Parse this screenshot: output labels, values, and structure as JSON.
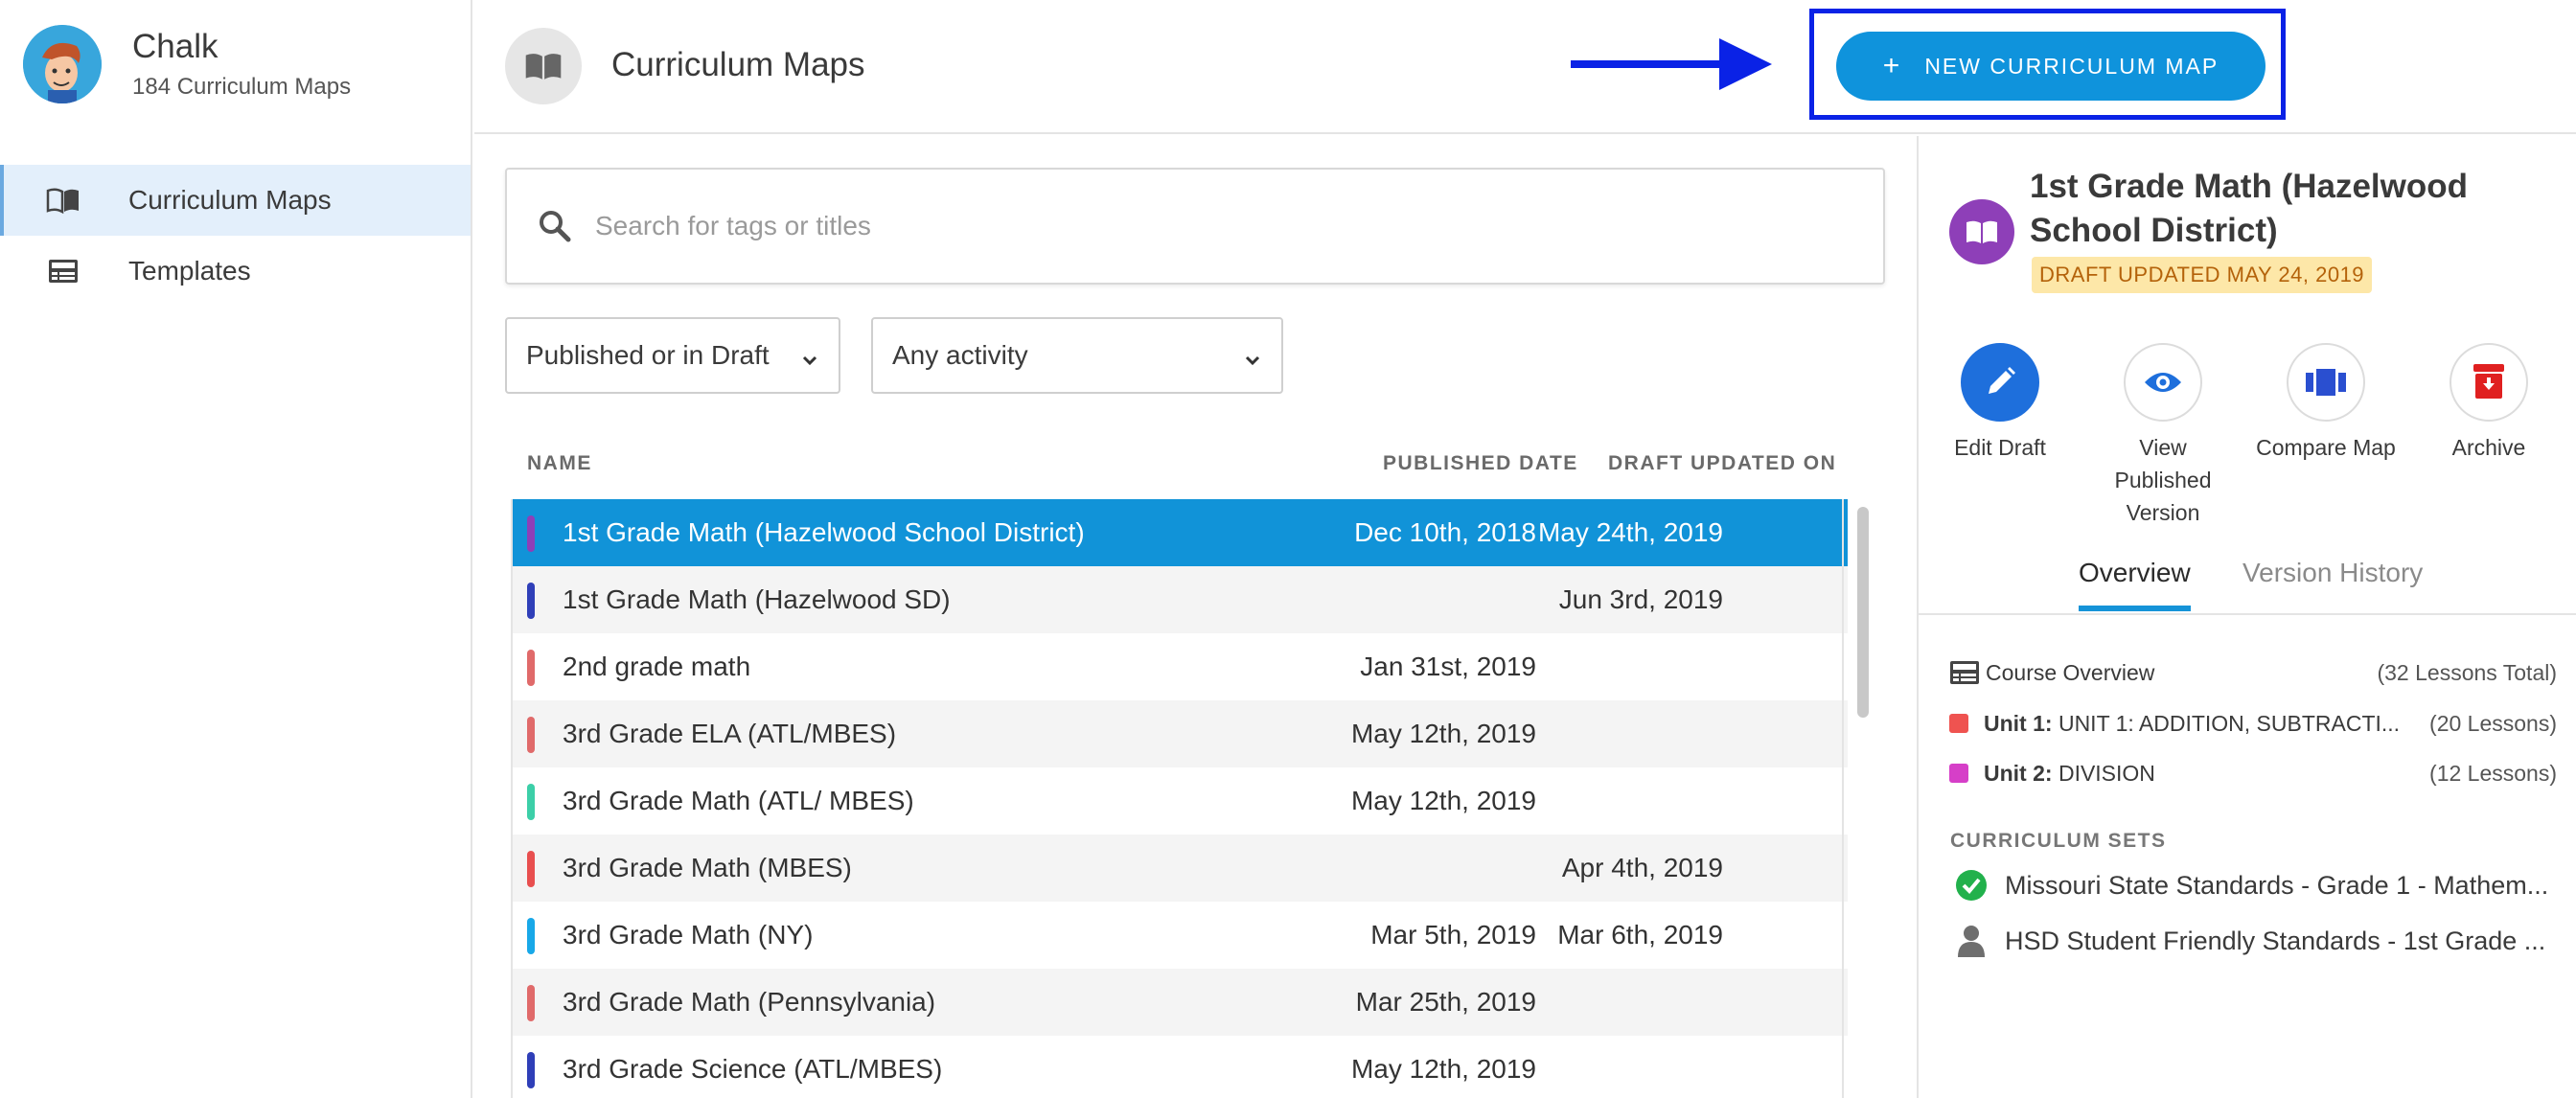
{
  "app": {
    "name": "Chalk",
    "subtitle": "184 Curriculum Maps"
  },
  "sidebar": {
    "items": [
      {
        "label": "Curriculum Maps",
        "icon": "book-icon",
        "active": true
      },
      {
        "label": "Templates",
        "icon": "template-icon",
        "active": false
      }
    ]
  },
  "header": {
    "title": "Curriculum Maps",
    "new_button_label": "NEW CURRICULUM MAP"
  },
  "search": {
    "placeholder": "Search for tags or titles"
  },
  "filters": {
    "status": "Published or in Draft",
    "activity": "Any activity"
  },
  "table": {
    "columns": {
      "name": "NAME",
      "published": "PUBLISHED DATE",
      "draft": "DRAFT UPDATED ON"
    },
    "rows": [
      {
        "name": "1st Grade Math (Hazelwood School District)",
        "published": "Dec 10th, 2018",
        "draft": "May 24th, 2019",
        "color": "#8e3fb8",
        "selected": true
      },
      {
        "name": "1st Grade Math (Hazelwood SD)",
        "published": "",
        "draft": "Jun 3rd, 2019",
        "color": "#2f3fb8",
        "selected": false
      },
      {
        "name": "2nd grade math",
        "published": "Jan 31st, 2019",
        "draft": "",
        "color": "#e06a6a",
        "selected": false
      },
      {
        "name": "3rd Grade ELA (ATL/MBES)",
        "published": "May 12th, 2019",
        "draft": "",
        "color": "#e06a6a",
        "selected": false
      },
      {
        "name": "3rd Grade Math (ATL/ MBES)",
        "published": "May 12th, 2019",
        "draft": "",
        "color": "#3ccfa8",
        "selected": false
      },
      {
        "name": "3rd Grade Math (MBES)",
        "published": "",
        "draft": "Apr 4th, 2019",
        "color": "#e84f4f",
        "selected": false
      },
      {
        "name": "3rd Grade Math (NY)",
        "published": "Mar 5th, 2019",
        "draft": "Mar 6th, 2019",
        "color": "#18a8e8",
        "selected": false
      },
      {
        "name": "3rd Grade Math (Pennsylvania)",
        "published": "Mar 25th, 2019",
        "draft": "",
        "color": "#e06a6a",
        "selected": false
      },
      {
        "name": "3rd Grade Science (ATL/MBES)",
        "published": "May 12th, 2019",
        "draft": "",
        "color": "#2f3fb8",
        "selected": false
      }
    ]
  },
  "detail": {
    "title": "1st Grade Math (Hazelwood School District)",
    "badge": "DRAFT UPDATED MAY 24, 2019",
    "actions": [
      {
        "label": "Edit Draft",
        "icon": "pencil-icon"
      },
      {
        "label": "View Published Version",
        "icon": "eye-icon"
      },
      {
        "label": "Compare Map",
        "icon": "compare-icon"
      },
      {
        "label": "Archive",
        "icon": "archive-icon"
      }
    ],
    "tabs": [
      "Overview",
      "Version History"
    ],
    "overview": {
      "course_label": "Course Overview",
      "course_count": "(32 Lessons Total)",
      "units": [
        {
          "prefix": "Unit 1:",
          "name": "UNIT 1: ADDITION, SUBTRACTI...",
          "count": "(20 Lessons)",
          "color": "#ef5350"
        },
        {
          "prefix": "Unit 2:",
          "name": "DIVISION",
          "count": "(12 Lessons)",
          "color": "#d63fc8"
        }
      ]
    },
    "sets_label": "CURRICULUM SETS",
    "sets": [
      {
        "name": "Missouri State Standards - Grade 1 - Mathem...",
        "icon": "check-circle-icon"
      },
      {
        "name": "HSD Student Friendly Standards - 1st Grade ...",
        "icon": "person-icon"
      }
    ]
  },
  "colors": {
    "accent": "#0f93dc",
    "highlight_frame": "#0a22e6",
    "arrow": "#0a22e6"
  }
}
